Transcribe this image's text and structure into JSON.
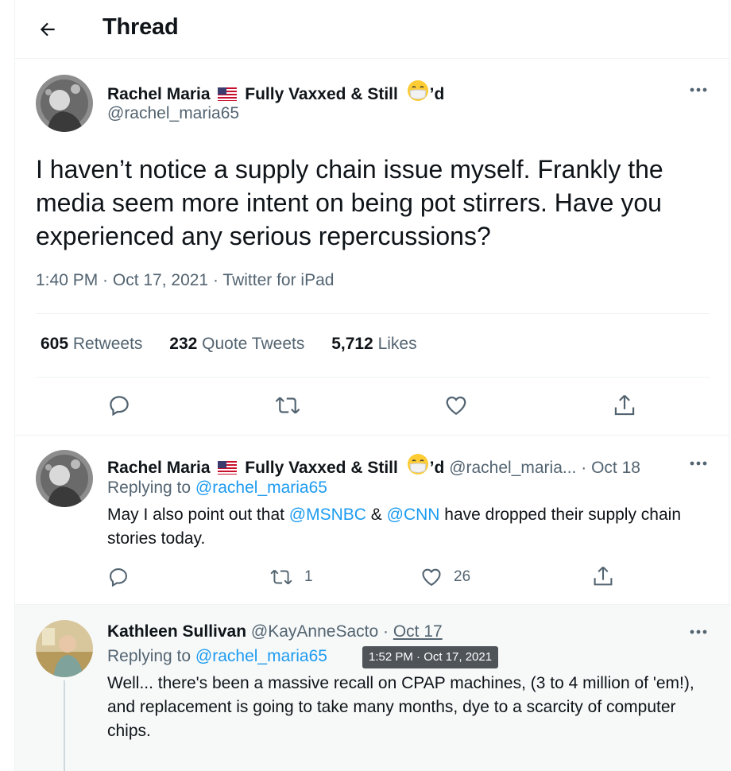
{
  "header": {
    "title": "Thread"
  },
  "main_tweet": {
    "name": "Rachel Maria",
    "name_suffix": "Fully Vaxxed & Still",
    "name_end": "’d",
    "handle": "@rachel_maria65",
    "text": "I haven’t notice a supply chain issue myself. Frankly the media seem more intent on being pot stirrers. Have you experienced any serious repercussions?",
    "time": "1:40 PM · Oct 17, 2021 · Twitter for iPad",
    "retweets_count": "605",
    "retweets_label": " Retweets",
    "quotes_count": "232",
    "quotes_label": " Quote Tweets",
    "likes_count": "5,712",
    "likes_label": " Likes"
  },
  "reply1": {
    "name": "Rachel Maria",
    "name_suffix": "Fully Vaxxed & Still",
    "name_end": "’d",
    "handle": "@rachel_maria...",
    "date": " · Oct 18",
    "replying_prefix": "Replying to ",
    "replying_to": "@rachel_maria65",
    "text_1": "May I also point out that ",
    "mention_1": "@MSNBC",
    "text_2": " & ",
    "mention_2": "@CNN",
    "text_3": " have dropped their supply chain stories today.",
    "retweet_count": "1",
    "like_count": "26"
  },
  "reply2": {
    "name": "Kathleen Sullivan",
    "handle": "@KayAnneSacto",
    "date_sep": " · ",
    "date": "Oct 17",
    "replying_prefix": "Replying to ",
    "replying_to": "@rachel_maria65",
    "tooltip": "1:52 PM · Oct 17, 2021",
    "text": "Well... there's been a massive recall on CPAP machines, (3 to 4 million of 'em!), and replacement is going to take many months, dye to a scarcity of computer chips."
  },
  "icons": {
    "back": "arrow-left-icon",
    "more": "more-horizontal-icon",
    "reply": "reply-icon",
    "retweet": "retweet-icon",
    "like": "heart-icon",
    "share": "share-icon"
  },
  "colors": {
    "link": "#1d9bf0",
    "secondary": "#536471",
    "primary": "#0f1419",
    "highlight_bg": "#f7f9f9"
  }
}
